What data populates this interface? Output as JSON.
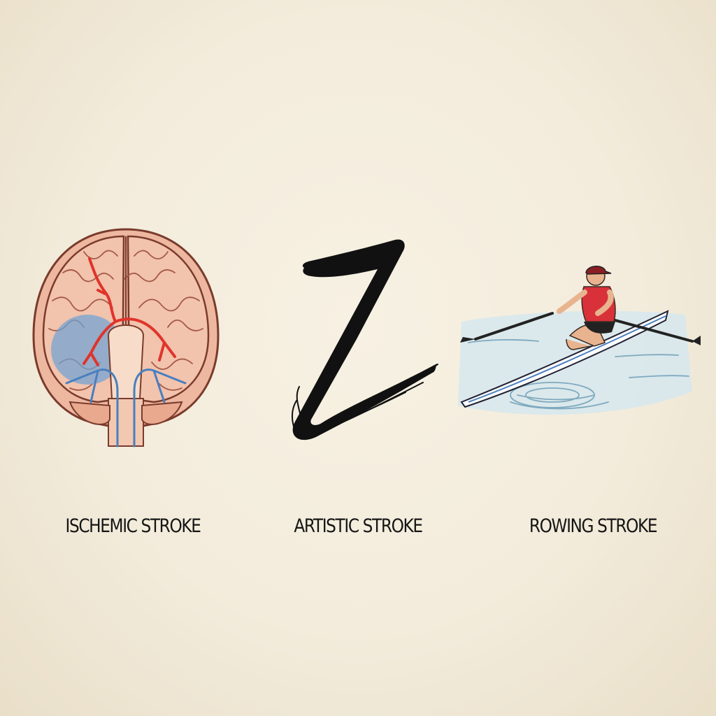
{
  "captions": {
    "ischemic": "ISCHEMIC STROKE",
    "artistic": "ARTISTIC STROKE",
    "rowing": "ROWING STROKE"
  },
  "colors": {
    "paper": "#f3ecdc",
    "brain": "#f2c3ad",
    "brain_outline": "#7a3b2c",
    "artery": "#e0342b",
    "vein": "#4a7fbf",
    "ischemia": "#6fa3d4",
    "ink": "#111111",
    "water": "#bcd8e4",
    "singlet": "#d8313a"
  },
  "illustrations": [
    {
      "name": "brain-illustration",
      "depicts": "brain with blocked artery and ischemic area"
    },
    {
      "name": "brush-stroke-illustration",
      "depicts": "black calligraphic ink brush stroke"
    },
    {
      "name": "rower-illustration",
      "depicts": "athlete rowing a single scull on water"
    }
  ]
}
